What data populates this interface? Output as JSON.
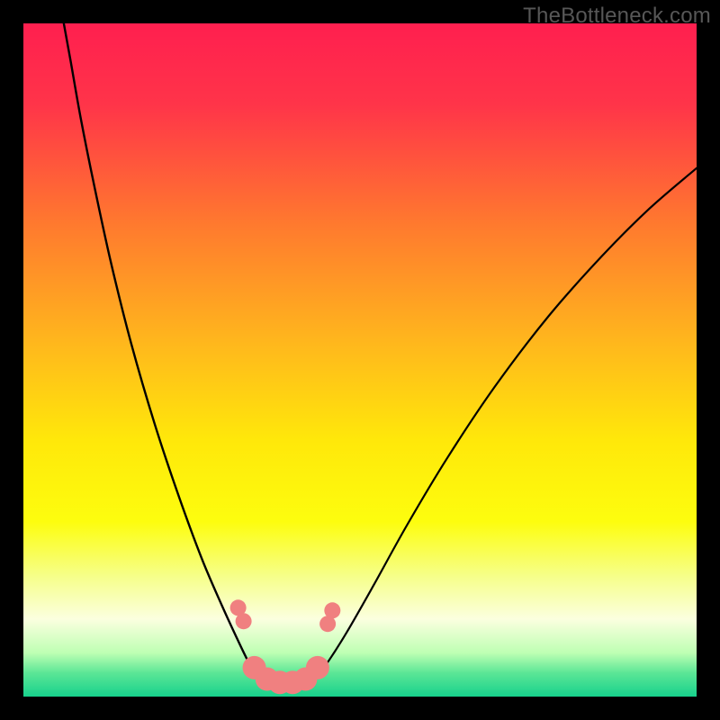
{
  "watermark": "TheBottleneck.com",
  "chart_data": {
    "type": "line",
    "title": "",
    "xlabel": "",
    "ylabel": "",
    "xlim": [
      0,
      100
    ],
    "ylim": [
      0,
      100
    ],
    "grid": false,
    "legend": false,
    "background_gradient": {
      "stops": [
        {
          "offset": 0.0,
          "color": "#ff1f4f"
        },
        {
          "offset": 0.12,
          "color": "#ff3449"
        },
        {
          "offset": 0.3,
          "color": "#ff7a2e"
        },
        {
          "offset": 0.48,
          "color": "#ffb91c"
        },
        {
          "offset": 0.62,
          "color": "#ffe80a"
        },
        {
          "offset": 0.74,
          "color": "#fdfd0e"
        },
        {
          "offset": 0.82,
          "color": "#f6ff88"
        },
        {
          "offset": 0.885,
          "color": "#fbffdf"
        },
        {
          "offset": 0.935,
          "color": "#beffb3"
        },
        {
          "offset": 0.965,
          "color": "#5be696"
        },
        {
          "offset": 1.0,
          "color": "#17d18c"
        }
      ]
    },
    "series": [
      {
        "name": "left-curve",
        "stroke": "#000000",
        "stroke_width": 2.4,
        "points": [
          {
            "x": 6.0,
            "y": 100.0
          },
          {
            "x": 7.0,
            "y": 94.5
          },
          {
            "x": 8.5,
            "y": 86.0
          },
          {
            "x": 10.5,
            "y": 76.0
          },
          {
            "x": 13.0,
            "y": 64.5
          },
          {
            "x": 16.0,
            "y": 52.5
          },
          {
            "x": 19.5,
            "y": 40.5
          },
          {
            "x": 23.0,
            "y": 30.0
          },
          {
            "x": 26.5,
            "y": 20.5
          },
          {
            "x": 29.5,
            "y": 13.5
          },
          {
            "x": 31.8,
            "y": 8.5
          },
          {
            "x": 33.5,
            "y": 5.0
          },
          {
            "x": 35.0,
            "y": 2.4
          },
          {
            "x": 36.0,
            "y": 1.3
          }
        ]
      },
      {
        "name": "right-curve",
        "stroke": "#000000",
        "stroke_width": 2.2,
        "points": [
          {
            "x": 42.0,
            "y": 1.3
          },
          {
            "x": 43.0,
            "y": 2.2
          },
          {
            "x": 45.0,
            "y": 4.8
          },
          {
            "x": 48.0,
            "y": 9.5
          },
          {
            "x": 52.0,
            "y": 16.5
          },
          {
            "x": 57.0,
            "y": 25.5
          },
          {
            "x": 63.0,
            "y": 35.5
          },
          {
            "x": 70.0,
            "y": 46.0
          },
          {
            "x": 78.0,
            "y": 56.5
          },
          {
            "x": 86.0,
            "y": 65.5
          },
          {
            "x": 93.0,
            "y": 72.5
          },
          {
            "x": 100.0,
            "y": 78.5
          }
        ]
      }
    ],
    "marker_cluster": {
      "name": "bottom-markers",
      "fill": "#f08080",
      "radius_main": 13,
      "radius_end": 9,
      "points": [
        {
          "x": 31.9,
          "y": 13.2,
          "r": 9
        },
        {
          "x": 32.7,
          "y": 11.2,
          "r": 9
        },
        {
          "x": 34.3,
          "y": 4.3,
          "r": 13
        },
        {
          "x": 36.2,
          "y": 2.6,
          "r": 13
        },
        {
          "x": 38.1,
          "y": 2.1,
          "r": 13
        },
        {
          "x": 40.0,
          "y": 2.1,
          "r": 13
        },
        {
          "x": 41.9,
          "y": 2.6,
          "r": 13
        },
        {
          "x": 43.7,
          "y": 4.3,
          "r": 13
        },
        {
          "x": 45.2,
          "y": 10.8,
          "r": 9
        },
        {
          "x": 45.9,
          "y": 12.8,
          "r": 9
        }
      ]
    }
  }
}
